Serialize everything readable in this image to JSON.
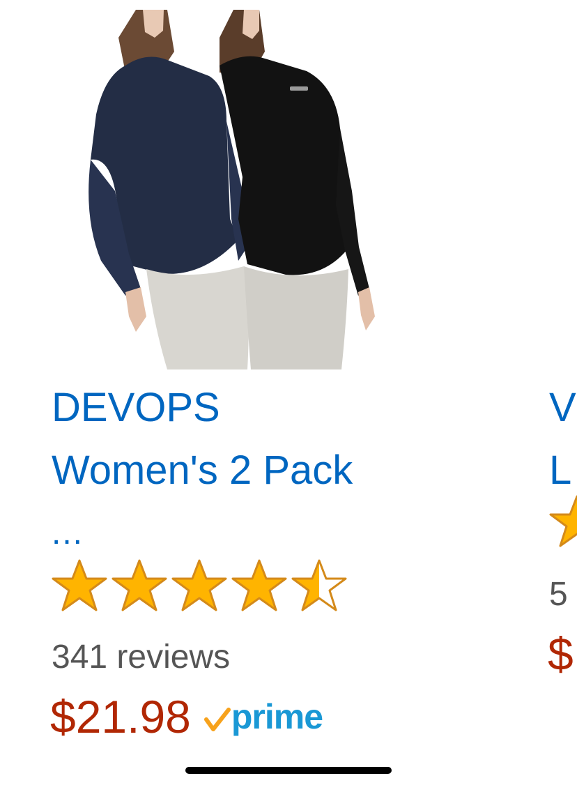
{
  "products": [
    {
      "image_icon": "two-women-long-sleeve-tops-image",
      "title_lines": [
        "DEVOPS",
        "Women's 2 Pack"
      ],
      "ellipsis": "...",
      "rating": 4.5,
      "rating_max": 5,
      "reviews": "341 reviews",
      "price": "$21.98",
      "prime": {
        "icon": "prime-check-icon",
        "label": "prime"
      }
    },
    {
      "title_lines": [
        "V",
        "L"
      ],
      "reviews": "5",
      "price": "$"
    }
  ],
  "colors": {
    "link": "#0066c0",
    "price": "#b12704",
    "secondary_text": "#555555",
    "star_fill": "#ffb400",
    "star_stroke": "#d48a1a",
    "prime_blue": "#1a98d5",
    "prime_check": "#f7a21c"
  }
}
